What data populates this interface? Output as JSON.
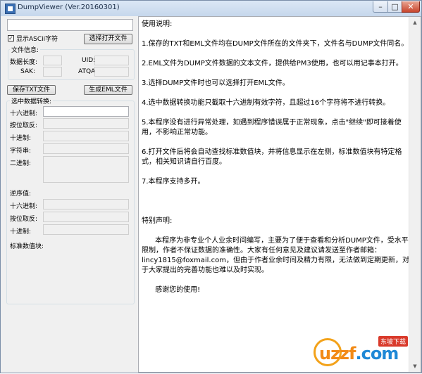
{
  "window": {
    "title": "DumpViewer (Ver.20160301)"
  },
  "controls": {
    "minimize": "–",
    "maximize": "□",
    "close": "✕"
  },
  "left": {
    "file_input_value": "",
    "show_ascii": {
      "label": "显示ASCii字符",
      "checked": true
    },
    "select_open_file": "选择打开文件",
    "file_info": {
      "title": "文件信息:",
      "data_length_label": "数据长度:",
      "uid_label": "UID:",
      "sak_label": "SAK:",
      "atqa_label": "ATQA:"
    },
    "save_txt": "保存TXT文件",
    "generate_eml": "生成EML文件",
    "convert": {
      "title": "选中数据转换:",
      "hex_label": "十六进制:",
      "bit_reverse_label": "按位取反:",
      "dec_label": "十进制:",
      "string_label": "字符串:",
      "bin_label": "二进制:"
    },
    "reverse": {
      "title": "逆序值:",
      "hex_label": "十六进制:",
      "bit_reverse_label": "按位取反:",
      "dec_label": "十进制:"
    },
    "standard_block_label": "标准数值块:"
  },
  "info_text": "使用说明:\n\n1.保存的TXT和EML文件均在DUMP文件所在的文件夹下，文件名与DUMP文件同名。\n\n2.EML文件为DUMP文件数据的文本文件，提供给PM3使用，也可以用记事本打开。\n\n3.选择DUMP文件时也可以选择打开EML文件。\n\n4.选中数据转换功能只截取十六进制有效字符，且超过16个字符将不进行转换。\n\n5.本程序没有进行异常处理，如遇到程序错误属于正常现象，点击\"继续\"即可接着使用，不影响正常功能。\n\n6.打开文件后将会自动查找标准数值块，并将信息显示在左侧，标准数值块有特定格式，相关知识请自行百度。\n\n7.本程序支持多开。\n\n\n\n特别声明:\n\n      本程序为非专业个人业余时间编写，主要为了便于查看和分析DUMP文件，受水平限制，作者不保证数据的准确性。大家有任何意见及建议请发送至作者邮箱：lincy1815@foxmail.com，但由于作者业余时间及精力有限，无法做到定期更新，对于大家提出的完善功能也难以及时实现。\n\n      感谢您的使用!",
  "watermark": {
    "badge": "东坡下载",
    "logo_main": "uzzf",
    "logo_suffix": ".com"
  }
}
